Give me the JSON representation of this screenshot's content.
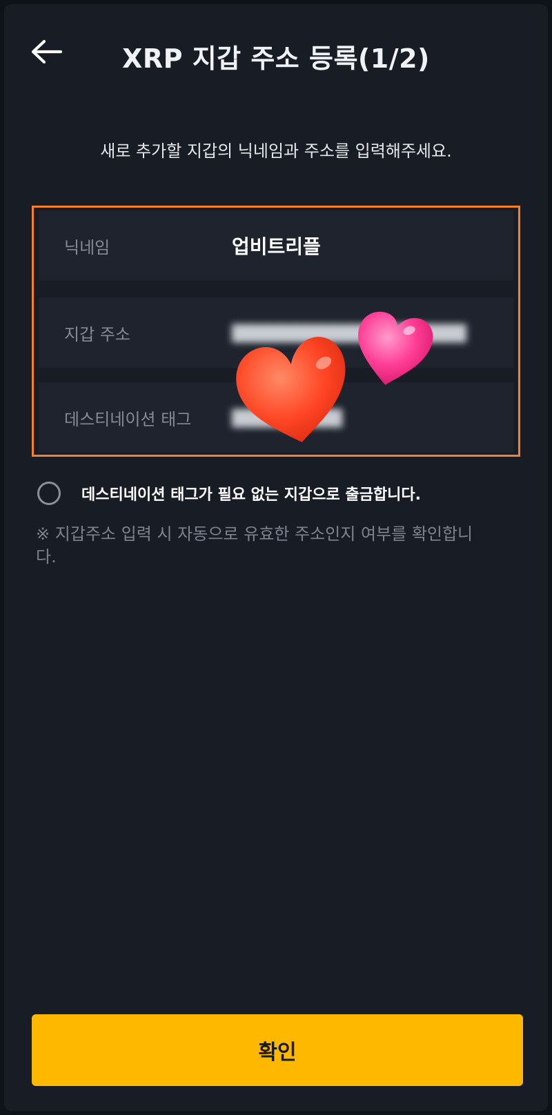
{
  "header": {
    "title": "XRP 지갑 주소 등록(1/2)",
    "back_icon": "arrow-left-icon"
  },
  "subtitle": "새로 추가할 지갑의 닉네임과 주소를 입력해주세요.",
  "form": {
    "nickname": {
      "label": "닉네임",
      "value": "업비트리플"
    },
    "address": {
      "label": "지갑 주소"
    },
    "destination_tag": {
      "label": "데스티네이션 태그"
    }
  },
  "no_tag_option": {
    "label": "데스티네이션 태그가 필요 없는 지갑으로 출금합니다.",
    "checked": false
  },
  "note": "※ 지갑주소 입력 시 자동으로 유효한 주소인지 여부를 확인합니다.",
  "confirm_button": {
    "label": "확인"
  },
  "colors": {
    "background": "#181c25",
    "field": "#1f232d",
    "highlight_border": "#f6812a",
    "accent": "#ffb800"
  }
}
